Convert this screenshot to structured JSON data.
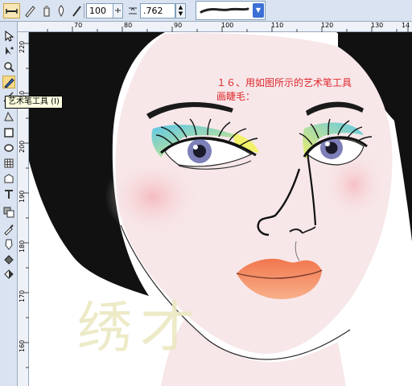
{
  "property_bar": {
    "smoothing_value": "100",
    "width_value": ".762 mm",
    "tools": [
      "preset-brush-icon",
      "brush-icon",
      "sprayer-icon",
      "calligraphic-icon",
      "pressure-icon"
    ]
  },
  "toolbox": {
    "tooltip": "艺术笔工具 (I)",
    "tools": [
      "pick-tool-icon",
      "shape-tool-icon",
      "zoom-tool-icon",
      "freehand-tool-icon",
      "artistic-media-tool-icon",
      "smart-fill-tool-icon",
      "rectangle-tool-icon",
      "ellipse-tool-icon",
      "graph-paper-tool-icon",
      "basic-shapes-tool-icon",
      "text-tool-icon",
      "interactive-blend-tool-icon",
      "eyedropper-tool-icon",
      "outline-pen-tool-icon",
      "fill-tool-icon",
      "interactive-fill-tool-icon"
    ]
  },
  "rulers": {
    "horizontal": [
      "70",
      "80",
      "90",
      "100",
      "110",
      "120",
      "130",
      "14"
    ],
    "vertical": [
      "220",
      "210",
      "200",
      "190",
      "180",
      "170",
      "160"
    ]
  },
  "canvas": {
    "instruction_line1": "１６、用如图所示的艺术笔工具",
    "instruction_line2": "画睫毛：",
    "watermark": "绣才"
  },
  "colors": {
    "ui_panel": "#d9e3f1",
    "instruction_text": "#e0262a",
    "hair": "#111111",
    "skin": "#f7e7e9",
    "lips": "#f08a66"
  }
}
